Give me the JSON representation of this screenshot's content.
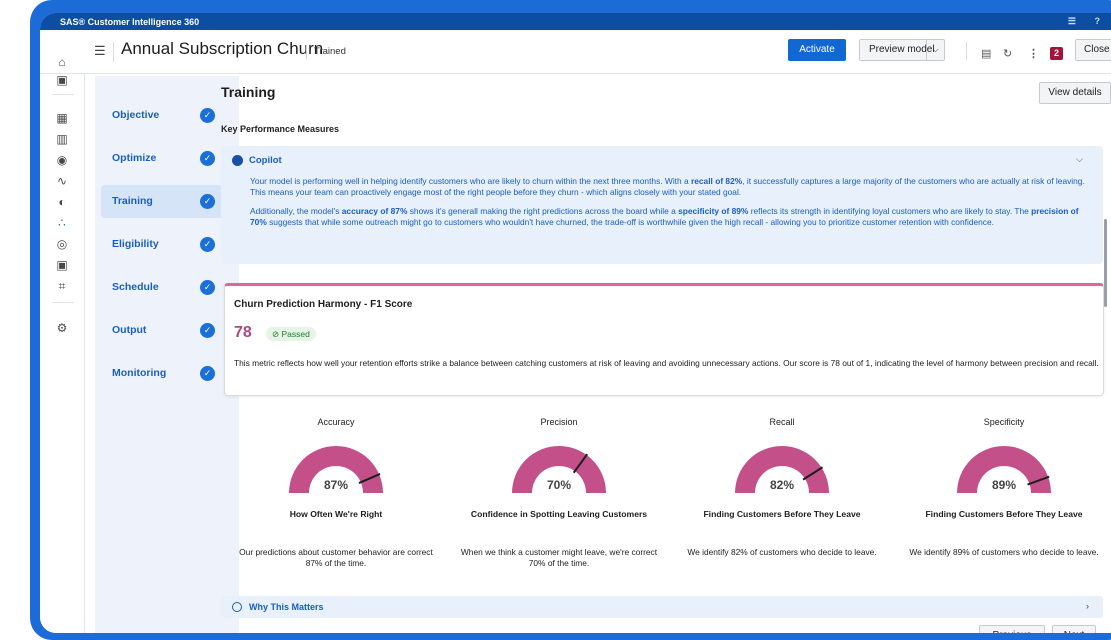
{
  "app": {
    "title": "SAS® Customer Intelligence 360"
  },
  "header": {
    "page_name": "Annual Subscription Churn",
    "status": "Trained",
    "activate_label": "Activate",
    "preview_label": "Preview model",
    "badge_count": "2",
    "close_label": "Close"
  },
  "steps": [
    {
      "label": "Objective",
      "state": "complete"
    },
    {
      "label": "Optimize",
      "state": "complete"
    },
    {
      "label": "Training",
      "state": "active"
    },
    {
      "label": "Eligibility",
      "state": "complete"
    },
    {
      "label": "Schedule",
      "state": "complete"
    },
    {
      "label": "Output",
      "state": "complete"
    },
    {
      "label": "Monitoring",
      "state": "complete"
    }
  ],
  "main": {
    "section_title": "Training",
    "view_details_label": "View details",
    "kpm_label": "Key Performance Measures",
    "copilot": {
      "title": "Copilot",
      "p1": [
        "Your model is performing well in helping identify customers who are likely to churn within the next three months. With a ",
        "recall of 82%",
        ", it successfully captures a large majority of the customers who are actually at risk of leaving. This means your team can proactively engage most of the right people before they churn - which aligns closely with your stated goal."
      ],
      "p2": [
        "Additionally, the model's ",
        "accuracy of 87%",
        " shows it's generall making the right predictions across the board while a ",
        "specificity of 89%",
        " reflects its strength in identifying loyal customers who are likely to stay. The ",
        "precision of 70%",
        " suggests that while some outreach might go to customers who wouldn't have churned, the trade-off is worthwhile given the high recall - allowing you to prioritize customer retention with confidence."
      ]
    },
    "metric": {
      "title": "Churn Prediction Harmony - F1 Score",
      "score": "78",
      "status": "⊘ Passed",
      "description": "This metric reflects how well your retention efforts strike a balance between catching customers at risk of leaving and avoiding unnecessary actions. Our score is 78 out of 1, indicating the level of harmony between precision and recall."
    },
    "gauges": [
      {
        "heading": "Accuracy",
        "value": "87%",
        "fraction": 0.87,
        "subtitle": "How Often We're Right",
        "description": "Our predictions about customer behavior are correct 87% of the time."
      },
      {
        "heading": "Precision",
        "value": "70%",
        "fraction": 0.7,
        "subtitle": "Confidence in Spotting Leaving Customers",
        "description": "When we think a customer might leave, we're correct 70% of the time."
      },
      {
        "heading": "Recall",
        "value": "82%",
        "fraction": 0.82,
        "subtitle": "Finding Customers Before They Leave",
        "description": "We identify 82% of customers who decide to leave."
      },
      {
        "heading": "Specificity",
        "value": "89%",
        "fraction": 0.89,
        "subtitle": "Finding Customers Before They Leave",
        "description": "We identify 89% of customers who decide to leave."
      }
    ],
    "why_label": "Why This Matters",
    "previous_label": "Previous",
    "next_label": "Next"
  },
  "colors": {
    "gauge": "#c4508a",
    "accent": "#1268d3",
    "pink_border": "#e4659b"
  }
}
